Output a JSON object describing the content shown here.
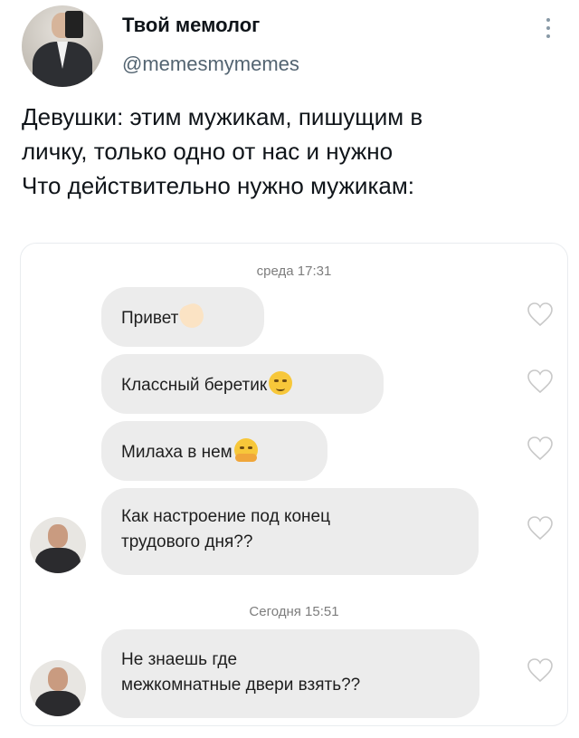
{
  "tweet": {
    "author_name": "Твой мемолог",
    "author_handle": "@memesmymemes",
    "text_lines": [
      "Девушки: этим мужикам, пишущим в",
      "личку, только одно от нас и нужно",
      "Что действительно нужно мужикам:"
    ]
  },
  "chat": {
    "date_1": "среда 17:31",
    "date_2": "Сегодня 15:51",
    "messages": [
      {
        "text": "Привет",
        "emoji": "waving-hand-emoji"
      },
      {
        "text": "Классный беретик",
        "emoji": "smirking-face-emoji"
      },
      {
        "text": "Милаха в нем",
        "emoji": "hugging-face-emoji"
      },
      {
        "text_line_1": "Как настроение под конец",
        "text_line_2": "трудового дня??"
      },
      {
        "text_line_1": "Не знаешь где",
        "text_line_2": "межкомнатные двери взять??"
      }
    ]
  },
  "colors": {
    "bubble_bg": "#ececec",
    "handle_gray": "#536471",
    "heart_outline": "#c8c8c8"
  }
}
